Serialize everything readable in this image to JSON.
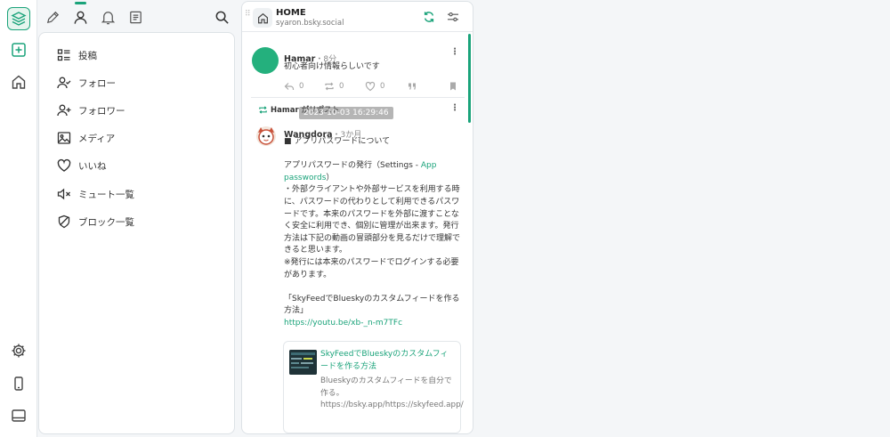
{
  "rail": {
    "items": [
      {
        "icon": "layers-icon"
      },
      {
        "icon": "add-column-icon"
      },
      {
        "icon": "home-icon"
      },
      {
        "icon": "gear-icon"
      },
      {
        "icon": "phone-icon"
      },
      {
        "icon": "panel-icon"
      }
    ]
  },
  "tabs": {
    "items": [
      {
        "icon": "pencil-icon"
      },
      {
        "icon": "profile-icon"
      },
      {
        "icon": "bell-icon"
      },
      {
        "icon": "list-icon"
      },
      {
        "icon": "search-icon"
      }
    ],
    "active_index": 1
  },
  "menu": {
    "items": [
      {
        "icon": "posts-icon",
        "label": "投稿"
      },
      {
        "icon": "follow-icon",
        "label": "フォロー"
      },
      {
        "icon": "follower-icon",
        "label": "フォロワー"
      },
      {
        "icon": "image-icon",
        "label": "メディア"
      },
      {
        "icon": "heart-icon",
        "label": "いいね"
      },
      {
        "icon": "mute-icon",
        "label": "ミュート一覧"
      },
      {
        "icon": "shield-icon",
        "label": "ブロック一覧"
      }
    ]
  },
  "column": {
    "title": "HOME",
    "subtitle": "syaron.bsky.social",
    "accent": "#1aa37a",
    "post1": {
      "author": "Hamar",
      "time": "・8分",
      "text": "初心者向け情報らしいです",
      "reply_count": "0",
      "repost_count": "0",
      "like_count": "0"
    },
    "repost_label": "Hamar がリポスト",
    "tooltip": "2023-10-03 16:29:46",
    "post2": {
      "author": "Wangdora",
      "time": "・3か月",
      "line1": "■ アプリパスワードについて",
      "para1_a": "アプリパスワードの発行（Settings - ",
      "para1_link": "App passwords",
      "para1_b": "）",
      "para2": "・外部クライアントや外部サービスを利用する時に、パスワードの代わりとして利用できるパスワードです。本来のパスワードを外部に渡すことなく安全に利用でき、個別に管理が出来ます。発行方法は下記の動画の冒頭部分を見るだけで理解できると思います。",
      "para3": "※発行には本来のパスワードでログインする必要があります。",
      "para4": "「SkyFeedでBlueskyのカスタムフィードを作る方法」",
      "link": "https://youtu.be/xb-_n-m7TFc"
    },
    "card": {
      "title": "SkyFeedでBlueskyのカスタムフィードを作る方法",
      "desc1": "Blueskyのカスタムフィードを自分で作る。",
      "desc2": "https://bsky.app/https://skyfeed.app/"
    }
  }
}
